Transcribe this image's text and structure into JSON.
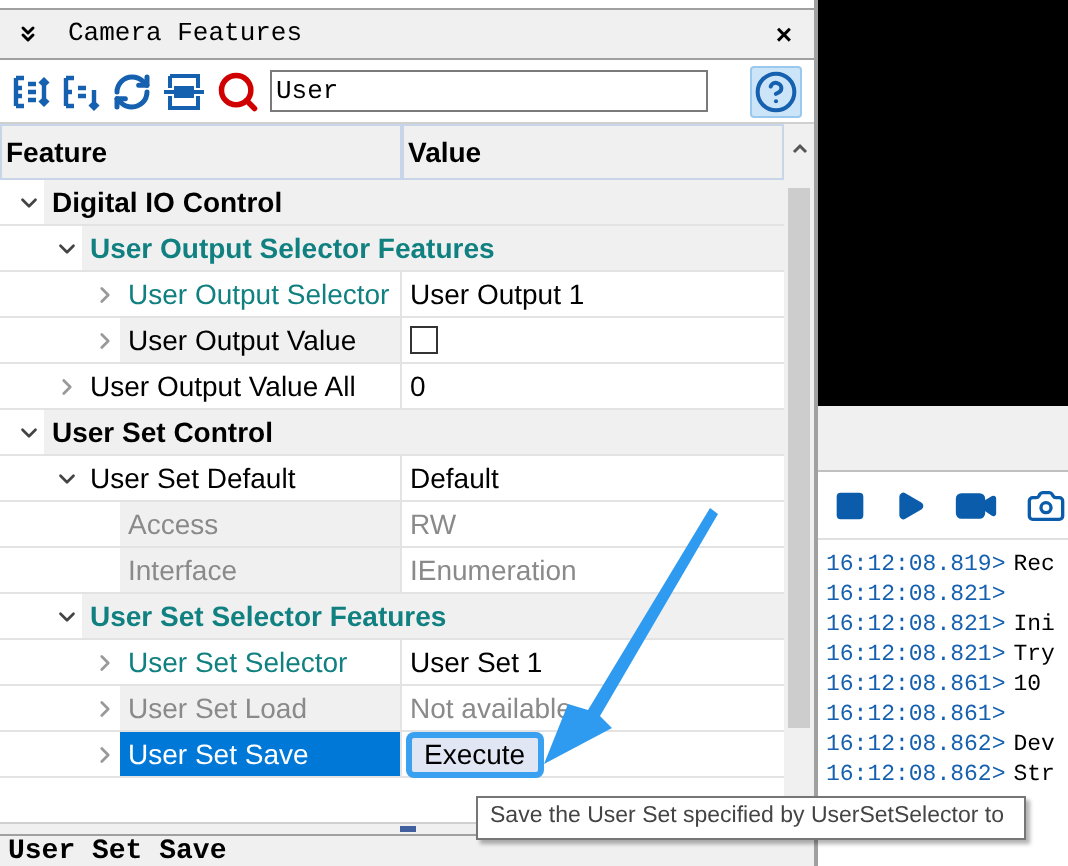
{
  "panel": {
    "title": "Camera Features",
    "close": "×"
  },
  "toolbar": {
    "search_value": "User"
  },
  "columns": [
    "Feature",
    "Value"
  ],
  "tree": [
    {
      "label": "Digital IO Control",
      "kind": "category",
      "accent": false,
      "expanded": true,
      "shaded": true,
      "children": [
        {
          "label": "User Output Selector Features",
          "kind": "category",
          "accent": true,
          "expanded": true,
          "shaded": true,
          "children": [
            {
              "label": "User Output Selector",
              "kind": "feature",
              "accent": true,
              "disabled": false,
              "expanded": false,
              "shaded": false,
              "selected": false,
              "value": {
                "kind": "text",
                "text": "User Output 1",
                "disabled": false
              }
            },
            {
              "label": "User Output Value",
              "kind": "feature",
              "accent": false,
              "disabled": false,
              "expanded": false,
              "shaded": true,
              "selected": false,
              "value": {
                "kind": "checkbox",
                "checked": false
              }
            }
          ]
        },
        {
          "label": "User Output Value All",
          "kind": "feature",
          "accent": false,
          "disabled": false,
          "expanded": false,
          "shaded": false,
          "selected": false,
          "value": {
            "kind": "text",
            "text": "0",
            "disabled": false
          }
        }
      ]
    },
    {
      "label": "User Set Control",
      "kind": "category",
      "accent": false,
      "expanded": true,
      "shaded": true,
      "children": [
        {
          "label": "User Set Default",
          "kind": "feature",
          "accent": false,
          "disabled": false,
          "expanded": true,
          "shaded": false,
          "selected": false,
          "value": {
            "kind": "text",
            "text": "Default",
            "disabled": false
          },
          "children": [
            {
              "label": "Access",
              "kind": "feature",
              "disabled": true,
              "shaded": true,
              "selected": false,
              "value": {
                "kind": "text",
                "text": "RW",
                "disabled": true
              }
            },
            {
              "label": "Interface",
              "kind": "feature",
              "disabled": true,
              "shaded": true,
              "selected": false,
              "value": {
                "kind": "text",
                "text": "IEnumeration",
                "disabled": true
              }
            }
          ]
        },
        {
          "label": "User Set Selector Features",
          "kind": "category",
          "accent": true,
          "expanded": true,
          "shaded": true,
          "children": [
            {
              "label": "User Set Selector",
              "kind": "feature",
              "accent": true,
              "disabled": false,
              "expanded": false,
              "shaded": false,
              "selected": false,
              "value": {
                "kind": "text",
                "text": "User Set 1",
                "disabled": false
              }
            },
            {
              "label": "User Set Load",
              "kind": "feature",
              "disabled": true,
              "expanded": false,
              "shaded": true,
              "selected": false,
              "value": {
                "kind": "text",
                "text": "Not available",
                "disabled": true
              }
            },
            {
              "label": "User Set Save",
              "kind": "feature",
              "expanded": false,
              "selected": true,
              "value": {
                "kind": "button",
                "text": "Execute",
                "highlighted": true
              }
            }
          ]
        }
      ]
    }
  ],
  "tooltip": "Save the User Set specified by UserSetSelector to",
  "status_text": "User Set Save",
  "log": [
    {
      "time": "16:12:08.819>",
      "message": "Rec"
    },
    {
      "time": "16:12:08.821>"
    },
    {
      "time": "16:12:08.821>",
      "message": "Ini"
    },
    {
      "time": "16:12:08.821>",
      "message": "Try"
    },
    {
      "time": "16:12:08.861>",
      "message": "10"
    },
    {
      "time": "16:12:08.861>"
    },
    {
      "time": "16:12:08.862>",
      "message": "Dev"
    },
    {
      "time": "16:12:08.862>",
      "message": "Str"
    }
  ]
}
